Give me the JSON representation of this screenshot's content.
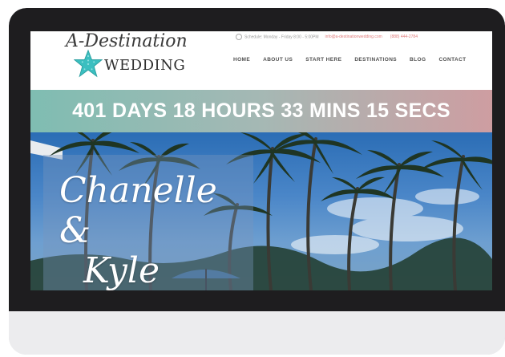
{
  "site": {
    "logo": {
      "line1": "A-Destination",
      "line2": "WEDDING"
    },
    "topbar": {
      "schedule": "Schedule: Monday - Friday 8:00 - 5:00PM",
      "email": "info@a-destinationwedding.com",
      "phone": "(888) 444-2784"
    },
    "nav": [
      "HOME",
      "ABOUT US",
      "START HERE",
      "DESTINATIONS",
      "BLOG",
      "CONTACT"
    ]
  },
  "countdown": {
    "days": "401",
    "days_label": "DAYS",
    "hours": "18",
    "hours_label": "HOURS",
    "mins": "33",
    "mins_label": "MINS",
    "secs": "15",
    "secs_label": "SECS"
  },
  "hero": {
    "name1": "Chanelle &",
    "name2": "Kyle"
  },
  "colors": {
    "countdown_start": "#7fbdb2",
    "countdown_end": "#ce9da1",
    "accent": "#e07c7c",
    "star": "#3bbfc0"
  },
  "icons": [
    "starfish-icon",
    "clock-icon"
  ]
}
